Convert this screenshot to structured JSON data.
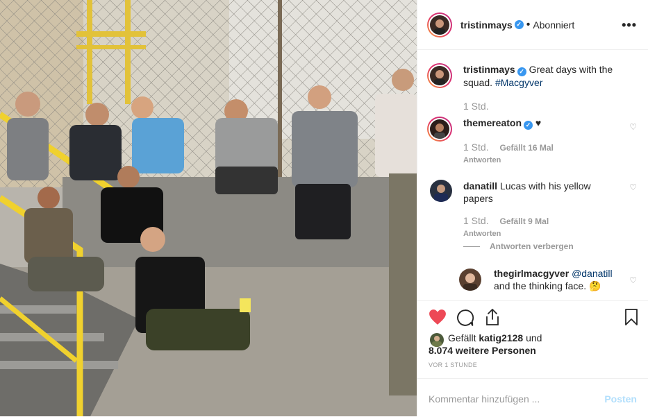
{
  "post": {
    "author": "tristinmays",
    "follow_status": "Abonniert",
    "separator": "•",
    "more_icon": "more-horizontal-icon",
    "caption_text": "Great days with the squad.",
    "caption_hashtag": "#Macgyver",
    "caption_time": "1 Std."
  },
  "comments": [
    {
      "user": "themereaton",
      "text": "♥",
      "time": "1 Std.",
      "likes": "Gefällt 16 Mal",
      "reply": "Antworten",
      "verified": true
    },
    {
      "user": "danatill",
      "text": "Lucas with his yellow papers",
      "time": "1 Std.",
      "likes": "Gefällt 9 Mal",
      "reply": "Antworten",
      "verified": false
    }
  ],
  "replies_toggle": "Antworten verbergen",
  "reply": {
    "user": "thegirlmacgyver",
    "mention": "@danatill",
    "text": "and the thinking face. 🤔"
  },
  "likes": {
    "liked_by": "katig2128",
    "line1_prefix": "Gefällt",
    "line1_suffix": "und",
    "line2": "8.074 weitere Personen"
  },
  "timestamp": "VOR 1 STUNDE",
  "add_comment": {
    "placeholder": "Kommentar hinzufügen ...",
    "post_label": "Posten"
  },
  "colors": {
    "liked_heart": "#ed4956",
    "verified": "#3897f0",
    "link": "#003569",
    "post_disabled": "#b2dffc"
  }
}
